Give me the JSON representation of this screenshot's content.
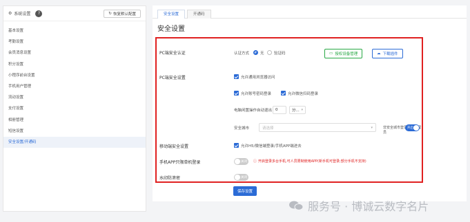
{
  "sidebar": {
    "title": "系统设置",
    "help_icon": "?",
    "reset_label": "恢复默认配置",
    "items": [
      {
        "label": "基本设置"
      },
      {
        "label": "考勤设置"
      },
      {
        "label": "会员消息设置"
      },
      {
        "label": "积分设置"
      },
      {
        "label": "小程序前台设置"
      },
      {
        "label": "手机用户管理"
      },
      {
        "label": "流动设置"
      },
      {
        "label": "支付设置"
      },
      {
        "label": "相册管理"
      },
      {
        "label": "短信设置"
      },
      {
        "label": "安全设置/开通码",
        "active": true
      }
    ]
  },
  "main": {
    "tabs": [
      {
        "label": "安全设置",
        "active": true
      },
      {
        "label": "开通码",
        "active": false
      }
    ],
    "page_title": "安全设置",
    "pc_auth": {
      "label": "PC端安全认证",
      "mode_label": "认证方式",
      "opt_none": "无",
      "opt_code": "验证码",
      "selected": "无",
      "btn_device": "授权设备管理",
      "btn_download": "下载插件"
    },
    "pc_security": {
      "label": "PC端安全设置",
      "cb_browser": "允许通用浏览器访问",
      "cb_account": "允许账号密码登录",
      "cb_wechat": "允许微信扫码登录",
      "auto_logout_label": "电脑闲置操作自动退出",
      "auto_logout_value": "0",
      "auto_logout_unit": "分...",
      "city_label": "安全城市",
      "city_placeholder": "请选择",
      "notify_label": "非安全城市登录通知管理员",
      "notify_state": "开启"
    },
    "mobile_security": {
      "label": "移动端安全设置",
      "cb_text": "允许H5/微信端登录/手机APP端进去"
    },
    "app_bind": {
      "label": "手机APP只限单机登录",
      "toggle_state": "关闭",
      "warning": "开启登录多台手机,可人员限制使用APP(新手机可登录;部分手机不支持)"
    },
    "watermark_defense": {
      "label": "水印防泄密",
      "toggle_state": "关闭"
    },
    "save_label": "保存设置"
  },
  "watermark_text": "服务号 · 博诚云数字名片",
  "colors": {
    "accent": "#2b6bd6",
    "highlight_box": "#e02020",
    "green": "#27a844"
  }
}
